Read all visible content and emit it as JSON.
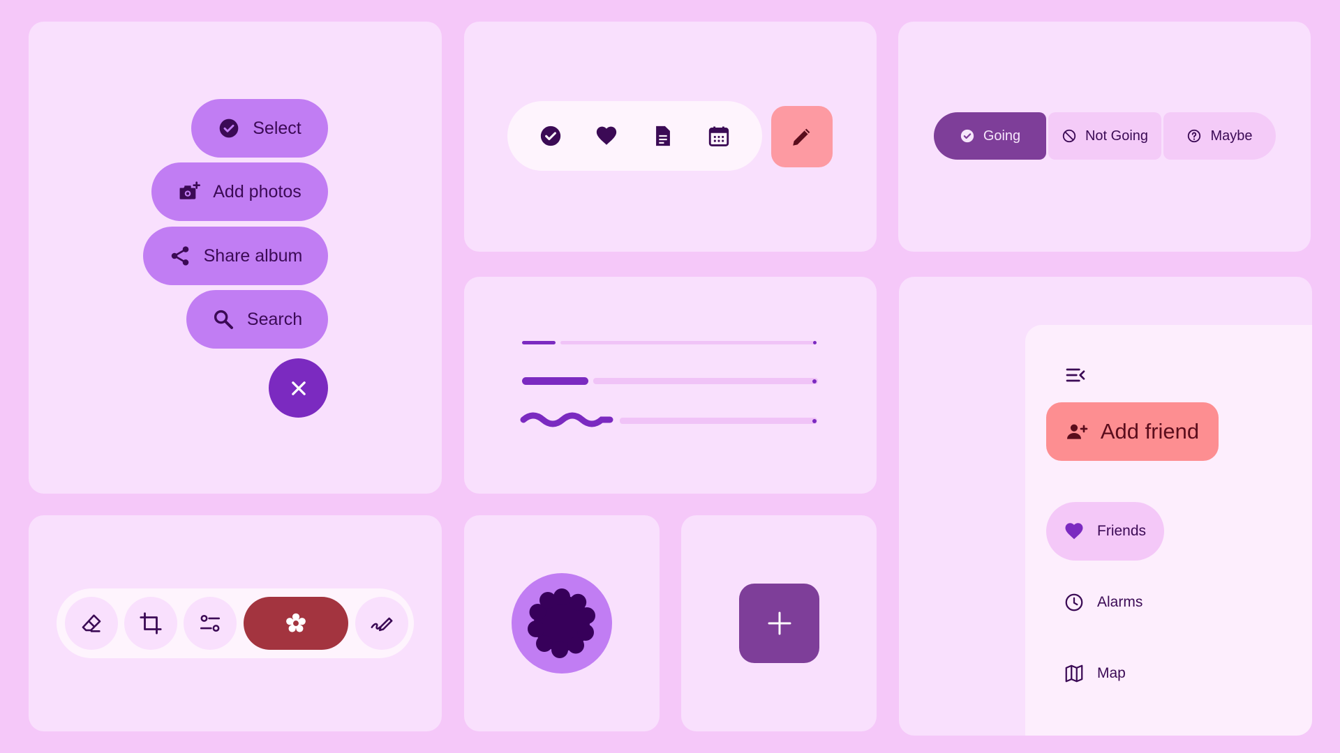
{
  "colors": {
    "background": "#f5c8f9",
    "card": "#f9e0fd",
    "pill": "#c17df3",
    "primary": "#7b2ac0",
    "dark": "#3b0a55",
    "coral": "#fd9aa2",
    "segmented_selected": "#7e3e99",
    "red": "#a3343f"
  },
  "fab_menu": {
    "items": [
      {
        "label": "Select",
        "icon": "check-circle-icon"
      },
      {
        "label": "Add photos",
        "icon": "add-photo-icon"
      },
      {
        "label": "Share album",
        "icon": "share-icon"
      },
      {
        "label": "Search",
        "icon": "search-icon"
      }
    ],
    "close_icon": "close-icon"
  },
  "toolbar": {
    "icons": [
      "check-circle-icon",
      "heart-icon",
      "document-icon",
      "calendar-icon"
    ],
    "fab_icon": "pencil-icon"
  },
  "segmented": {
    "options": [
      {
        "label": "Going",
        "icon": "check-circle-icon",
        "selected": true
      },
      {
        "label": "Not Going",
        "icon": "block-icon",
        "selected": false
      },
      {
        "label": "Maybe",
        "icon": "help-circle-icon",
        "selected": false
      }
    ]
  },
  "progress": {
    "items": [
      {
        "style": "thin",
        "value": 0.11
      },
      {
        "style": "thick",
        "value": 0.22
      },
      {
        "style": "wavy",
        "value": 0.31
      }
    ]
  },
  "nav": {
    "menu_icon": "menu-collapse-icon",
    "fab_label": "Add friend",
    "fab_icon": "person-add-icon",
    "items": [
      {
        "label": "Friends",
        "icon": "heart-icon",
        "active": true
      },
      {
        "label": "Alarms",
        "icon": "clock-icon",
        "active": false
      },
      {
        "label": "Map",
        "icon": "map-icon",
        "active": false
      }
    ]
  },
  "edit_toolbar": {
    "icons": [
      "eraser-icon",
      "crop-icon",
      "adjust-icon",
      "flower-settings-icon",
      "pen-icon"
    ],
    "selected": "flower-settings-icon"
  },
  "shape": {
    "icon": "scalloped-circle-icon"
  },
  "add_fab": {
    "icon": "plus-icon"
  }
}
